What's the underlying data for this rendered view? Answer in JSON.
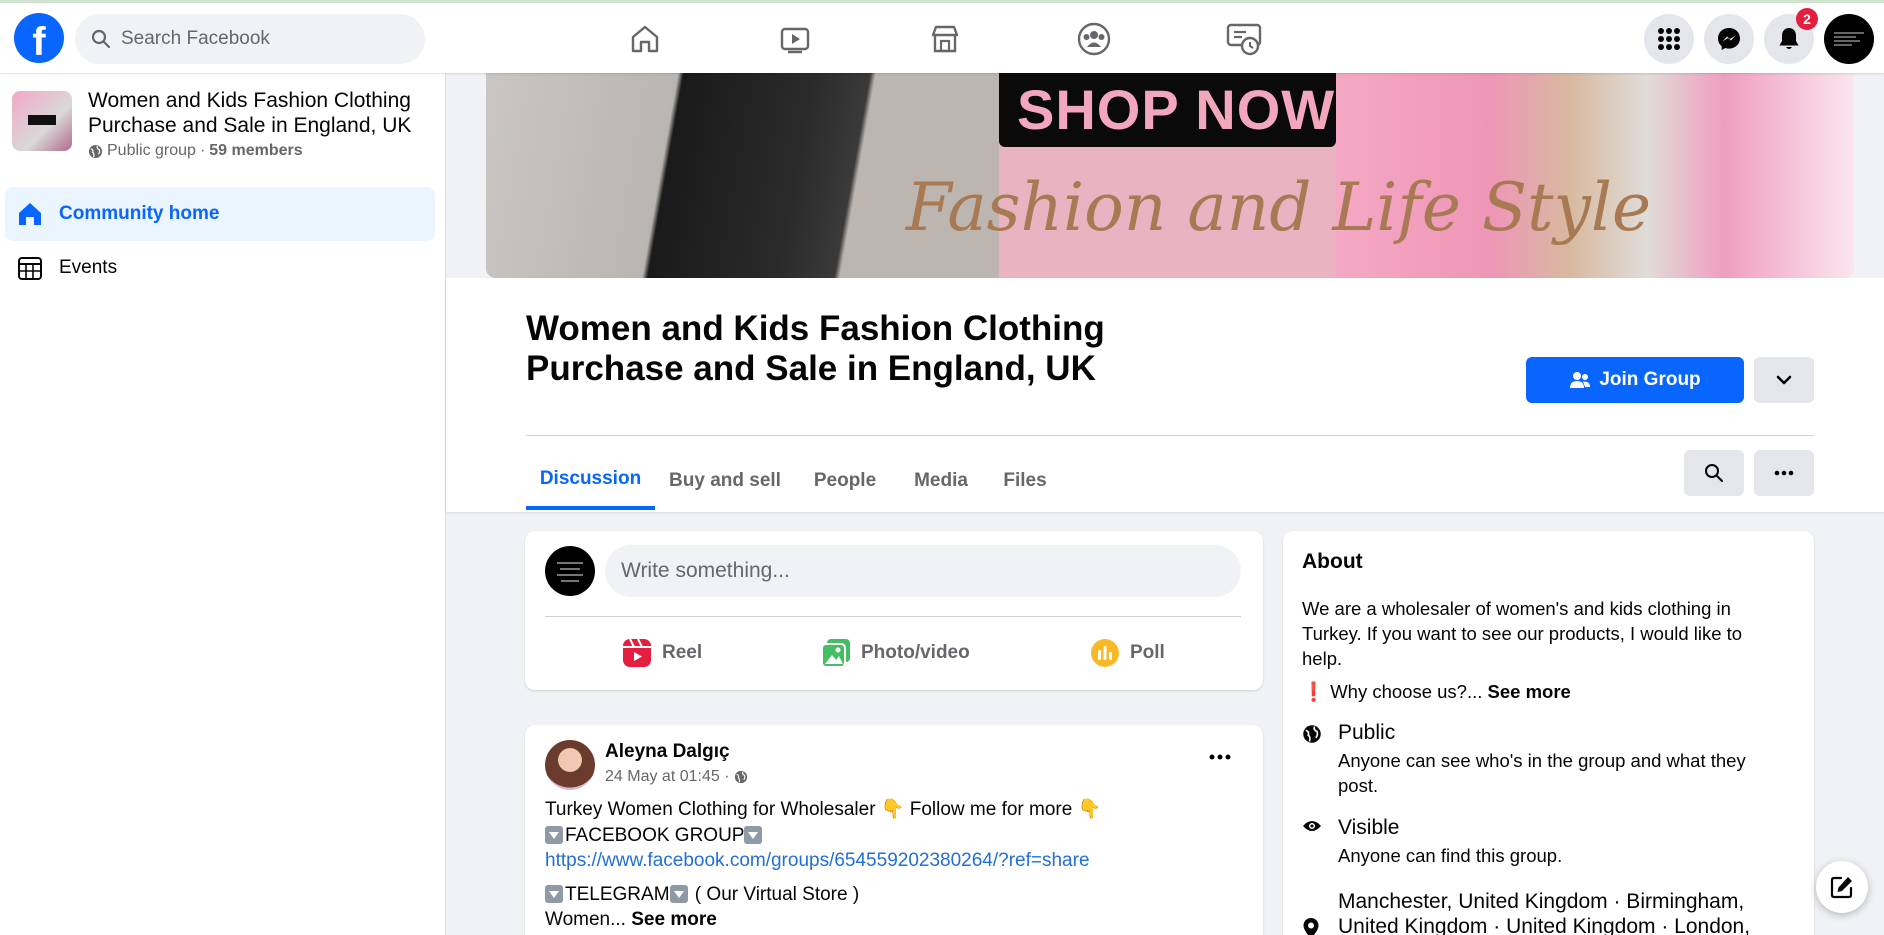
{
  "topbar": {
    "logo": "f",
    "search_placeholder": "Search Facebook",
    "nav_icons": [
      "home-icon",
      "video-icon",
      "marketplace-icon",
      "groups-icon",
      "gaming-icon"
    ],
    "right_icons": [
      "menu-grid-icon",
      "messenger-icon",
      "notifications-icon"
    ],
    "notification_count": "2"
  },
  "sidebar": {
    "group_name": "Women and Kids Fashion Clothing Purchase and Sale in England, UK",
    "privacy": "Public group",
    "separator": "·",
    "members": "59 members",
    "items": [
      {
        "label": "Community home",
        "icon": "home-icon",
        "active": true
      },
      {
        "label": "Events",
        "icon": "calendar-icon",
        "active": false
      }
    ]
  },
  "cover": {
    "shop_text": "SHOP NOW",
    "script_text": "Fashion and Life Style"
  },
  "header": {
    "title": "Women and Kids Fashion Clothing Purchase and Sale in England, UK",
    "join_label": "Join Group"
  },
  "tabs": [
    {
      "label": "Discussion",
      "active": true
    },
    {
      "label": "Buy and sell",
      "active": false
    },
    {
      "label": "People",
      "active": false
    },
    {
      "label": "Media",
      "active": false
    },
    {
      "label": "Files",
      "active": false
    }
  ],
  "composer": {
    "placeholder": "Write something...",
    "actions": [
      {
        "label": "Reel",
        "color": "#e41e3f"
      },
      {
        "label": "Photo/video",
        "color": "#45bd62"
      },
      {
        "label": "Poll",
        "color": "#f7b928"
      }
    ]
  },
  "post": {
    "author": "Aleyna Dalgıç",
    "time": "24 May at 01:45 ·",
    "line1": "Turkey Women Clothing for Wholesaler 👇  Follow me for more 👇",
    "line2": "FACEBOOK GROUP",
    "link": "https://www.facebook.com/groups/654559202380264/?ref=share",
    "line4": " ( Our Virtual Store )",
    "line4_prefix": "TELEGRAM",
    "line5": "Women...",
    "see_more": "See more"
  },
  "about": {
    "title": "About",
    "description": "We are a wholesaler of women's and kids clothing in Turkey. If you want to see our products, I would like to help.",
    "why_prefix": "❗",
    "why_text": "Why choose us?...",
    "see_more": "See more",
    "public_title": "Public",
    "public_desc": "Anyone can see who's in the group and what they post.",
    "visible_title": "Visible",
    "visible_desc": "Anyone can find this group.",
    "location": "Manchester, United Kingdom · Birmingham, United Kingdom · United Kingdom · London,"
  },
  "colors": {
    "brand": "#0866ff",
    "link": "#216fdb",
    "badge": "#e41e3f"
  }
}
